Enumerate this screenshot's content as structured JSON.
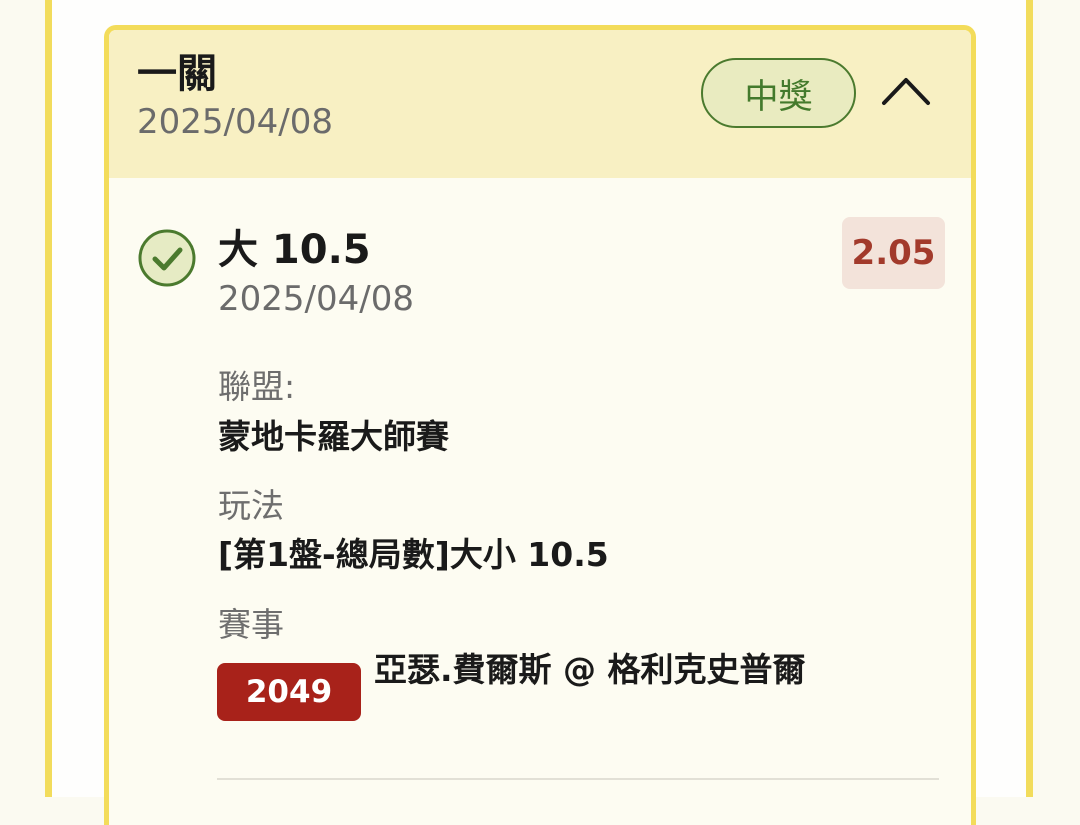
{
  "bet": {
    "type_label": "一關",
    "date": "2025/04/08",
    "status_badge": "中獎",
    "collapse_icon": "chevron-up-icon"
  },
  "selection": {
    "status_icon": "check-circle-icon",
    "title": "大 10.5",
    "date": "2025/04/08",
    "odds": "2.05",
    "league_label": "聯盟:",
    "league_value": "蒙地卡羅大師賽",
    "market_label": "玩法",
    "market_value": "[第1盤-總局數]大小 10.5",
    "event_label": "賽事",
    "event_id": "2049",
    "event_name": "亞瑟.費爾斯 @ 格利克史普爾"
  },
  "colors": {
    "card_border": "#f3dc5a",
    "header_bg": "#f8f0c3",
    "win_green": "#447a2c",
    "odds_red": "#a23a2b",
    "event_id_bg": "#a8221a"
  }
}
